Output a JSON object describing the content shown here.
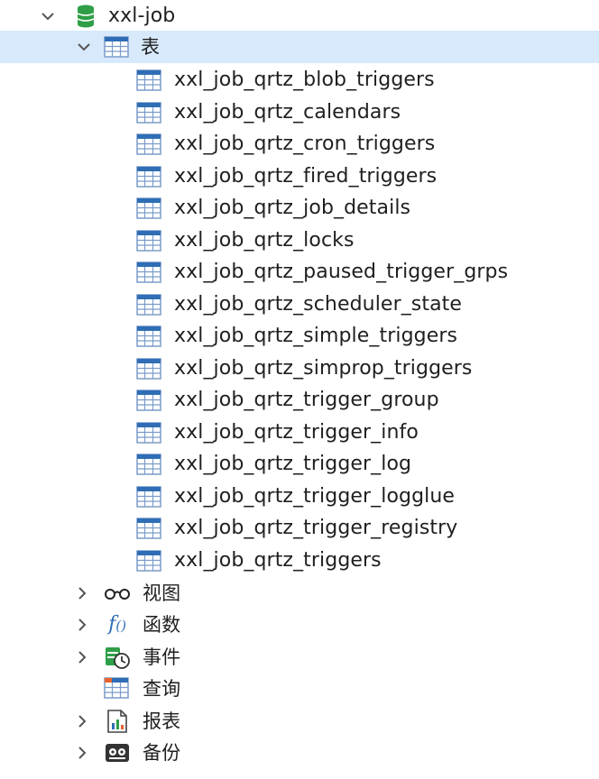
{
  "tree": {
    "database": {
      "label": "xxl-job",
      "icon": "database-icon",
      "expanded": true,
      "color": "#2e9f47"
    },
    "tables_node": {
      "label": "表",
      "icon": "table-grid-icon",
      "expanded": true,
      "selected": true
    },
    "tables": [
      {
        "label": "xxl_job_qrtz_blob_triggers"
      },
      {
        "label": "xxl_job_qrtz_calendars"
      },
      {
        "label": "xxl_job_qrtz_cron_triggers"
      },
      {
        "label": "xxl_job_qrtz_fired_triggers"
      },
      {
        "label": "xxl_job_qrtz_job_details"
      },
      {
        "label": "xxl_job_qrtz_locks"
      },
      {
        "label": "xxl_job_qrtz_paused_trigger_grps"
      },
      {
        "label": "xxl_job_qrtz_scheduler_state"
      },
      {
        "label": "xxl_job_qrtz_simple_triggers"
      },
      {
        "label": "xxl_job_qrtz_simprop_triggers"
      },
      {
        "label": "xxl_job_qrtz_trigger_group"
      },
      {
        "label": "xxl_job_qrtz_trigger_info"
      },
      {
        "label": "xxl_job_qrtz_trigger_log"
      },
      {
        "label": "xxl_job_qrtz_trigger_logglue"
      },
      {
        "label": "xxl_job_qrtz_trigger_registry"
      },
      {
        "label": "xxl_job_qrtz_triggers"
      }
    ],
    "other_nodes": [
      {
        "label": "视图",
        "icon": "view-glasses-icon",
        "expandable": true
      },
      {
        "label": "函数",
        "icon": "function-icon",
        "icon_text": "f()",
        "expandable": true
      },
      {
        "label": "事件",
        "icon": "event-clock-icon",
        "expandable": true
      },
      {
        "label": "查询",
        "icon": "query-icon",
        "expandable": false
      },
      {
        "label": "报表",
        "icon": "report-icon",
        "expandable": true
      },
      {
        "label": "备份",
        "icon": "backup-icon",
        "expandable": true
      }
    ]
  },
  "colors": {
    "selected_row": "#d7e9fb",
    "table_icon_header": "#2f6eb5",
    "table_icon_grid": "#7b9cc9",
    "chevron": "#555555",
    "text": "#1f1f1f"
  }
}
